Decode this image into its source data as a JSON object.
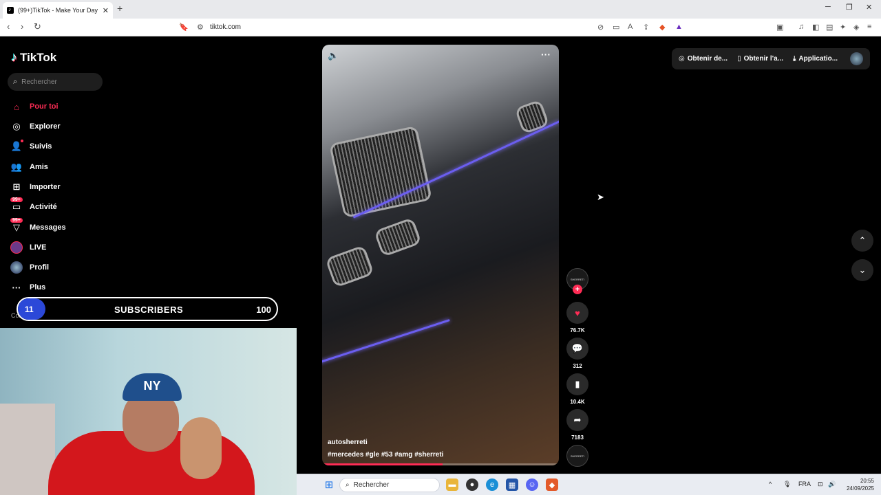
{
  "browser": {
    "tab_title": "(99+)TikTok - Make Your Day",
    "url": "tiktok.com"
  },
  "sidebar": {
    "logo": "TikTok",
    "search_placeholder": "Rechercher",
    "items": [
      {
        "label": "Pour toi",
        "icon": "home-icon"
      },
      {
        "label": "Explorer",
        "icon": "compass-icon"
      },
      {
        "label": "Suivis",
        "icon": "following-icon"
      },
      {
        "label": "Amis",
        "icon": "friends-icon"
      },
      {
        "label": "Importer",
        "icon": "upload-icon"
      },
      {
        "label": "Activité",
        "icon": "activity-icon",
        "badge": "99+"
      },
      {
        "label": "Messages",
        "icon": "messages-icon",
        "badge": "99+"
      },
      {
        "label": "LIVE",
        "icon": "live-icon"
      },
      {
        "label": "Profil",
        "icon": "profile-icon"
      },
      {
        "label": "Plus",
        "icon": "more-icon"
      }
    ],
    "comptes_suivis": "Comptes suivis"
  },
  "subscribers": {
    "count": "11",
    "label": "SUBSCRIBERS",
    "goal": "100"
  },
  "webcam": {
    "cap_text": "NY"
  },
  "video": {
    "author": "autosherreti",
    "tags": "#mercedes #gle #53 #amg #sherreti",
    "progress": 0.51
  },
  "actions": {
    "channel_avatar": "SHERRETI",
    "likes": "76.7K",
    "comments": "312",
    "saves": "10.4K",
    "shares": "7183"
  },
  "topbar": {
    "item1": "Obtenir de...",
    "item2": "Obtenir l'a...",
    "item3": "Applicatio..."
  },
  "taskbar": {
    "search": "Rechercher",
    "lang": "FRA",
    "time": "20:55",
    "date": "24/09/2025"
  }
}
